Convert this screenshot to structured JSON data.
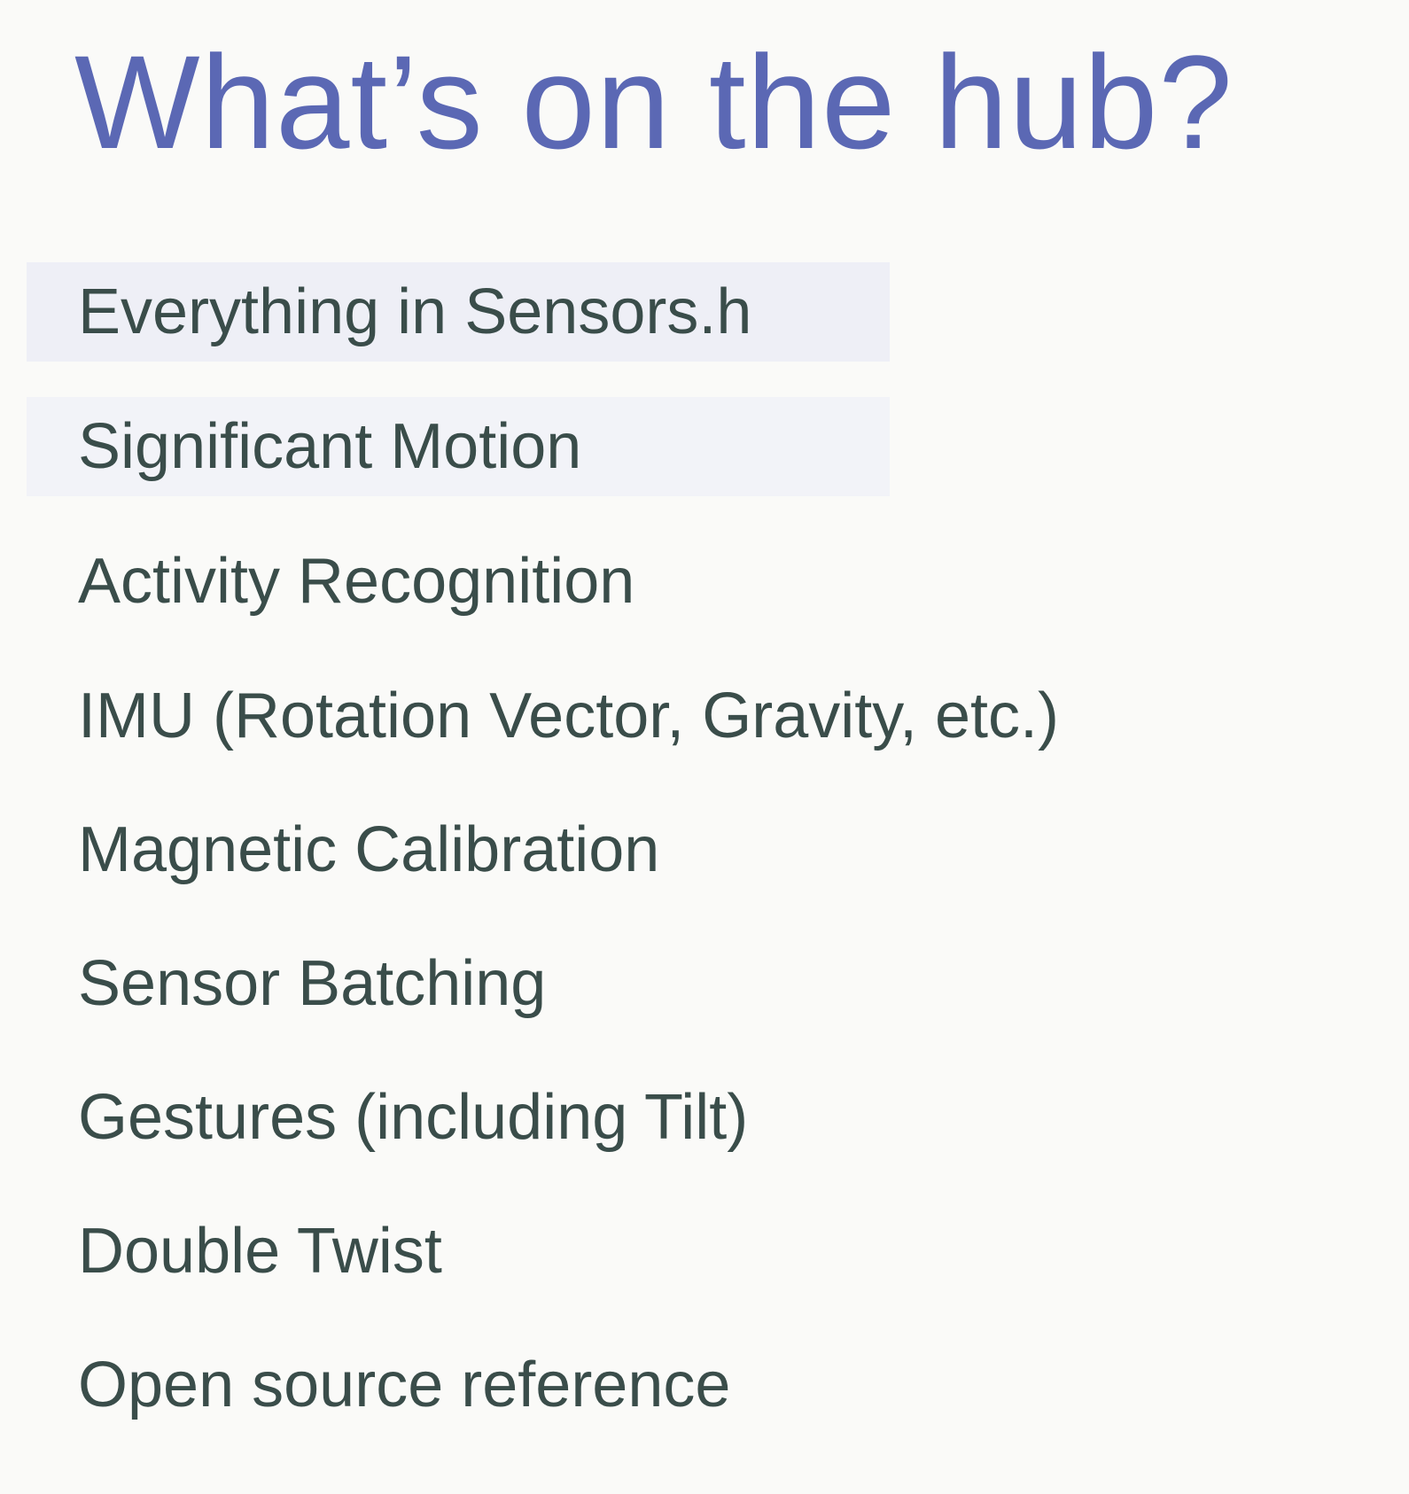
{
  "slide": {
    "title": "What’s on the hub?",
    "items": [
      "Everything in Sensors.h",
      "Significant Motion",
      "Activity Recognition",
      "IMU (Rotation Vector, Gravity, etc.)",
      "Magnetic Calibration",
      "Sensor Batching",
      "Gestures (including Tilt)",
      "Double Twist",
      "Open source reference"
    ]
  },
  "colors": {
    "background": "#fafaf8",
    "title": "#5b68b4",
    "text": "#3a4d4a",
    "highlight": "#eeeff6"
  }
}
